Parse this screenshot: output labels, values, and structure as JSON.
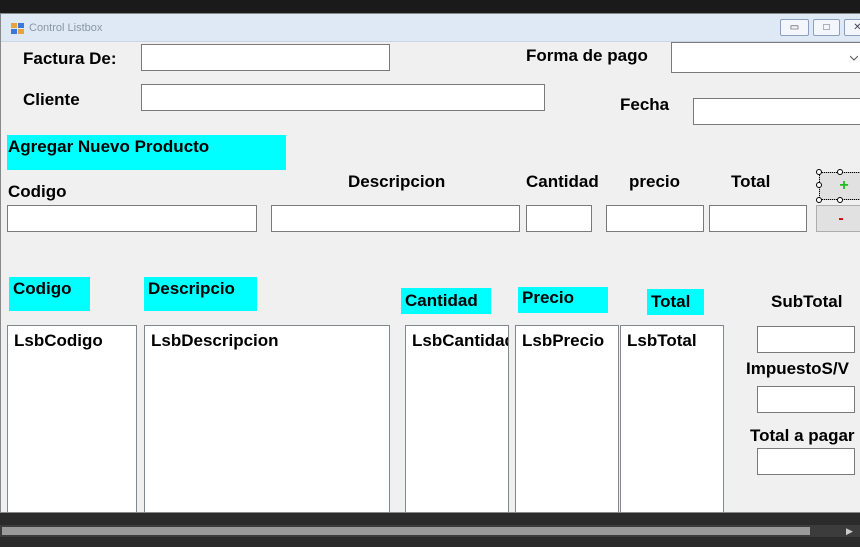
{
  "window": {
    "title": "Control Listbox",
    "controls": {
      "minimize": "▭",
      "maximize": "□",
      "close": "✕"
    }
  },
  "header": {
    "factura_label": "Factura De:",
    "factura_value": "",
    "cliente_label": "Cliente",
    "cliente_value": "",
    "forma_pago_label": "Forma de pago",
    "forma_pago_value": "",
    "fecha_label": "Fecha",
    "fecha_value": ""
  },
  "product": {
    "section_title": "Agregar Nuevo Producto",
    "codigo_label": "Codigo",
    "descripcion_label": "Descripcion",
    "cantidad_label": "Cantidad",
    "precio_label": "precio",
    "total_label": "Total",
    "add_button": "+",
    "remove_button": "-"
  },
  "lists": {
    "codigo_header": "Codigo",
    "descripcion_header": "Descripcio",
    "cantidad_header": "Cantidad",
    "precio_header": "Precio",
    "total_header": "Total",
    "codigo_item": "LsbCodigo",
    "descripcion_item": "LsbDescripcion",
    "cantidad_item": "LsbCantidad",
    "precio_item": "LsbPrecio",
    "total_item": "LsbTotal"
  },
  "summary": {
    "subtotal_label": "SubTotal",
    "impuesto_label": "ImpuestoS/V",
    "total_pagar_label": "Total a pagar"
  },
  "colors": {
    "highlight": "#00ffff",
    "titlebar": "#dfe9f5",
    "form_bg": "#f0f0f0"
  },
  "icons": {
    "app": "form-icon",
    "combo": "chevron-down-icon"
  }
}
